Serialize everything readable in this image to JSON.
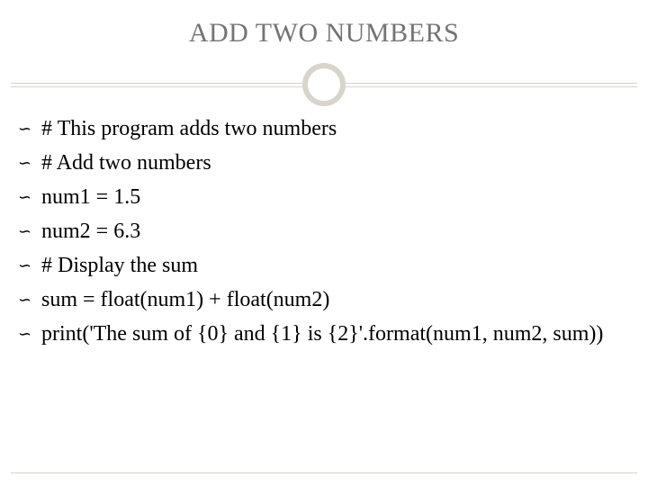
{
  "title": "ADD TWO NUMBERS",
  "bullets": {
    "b0": "# This program adds two numbers",
    "b1": "# Add two numbers",
    "b2": "num1 = 1.5",
    "b3": "num2 = 6.3",
    "b4": "# Display the sum",
    "b5": "sum = float(num1) + float(num2)",
    "b6": "print('The sum of {0} and {1} is {2}'.format(num1, num2, sum))"
  },
  "glyph": "➢"
}
